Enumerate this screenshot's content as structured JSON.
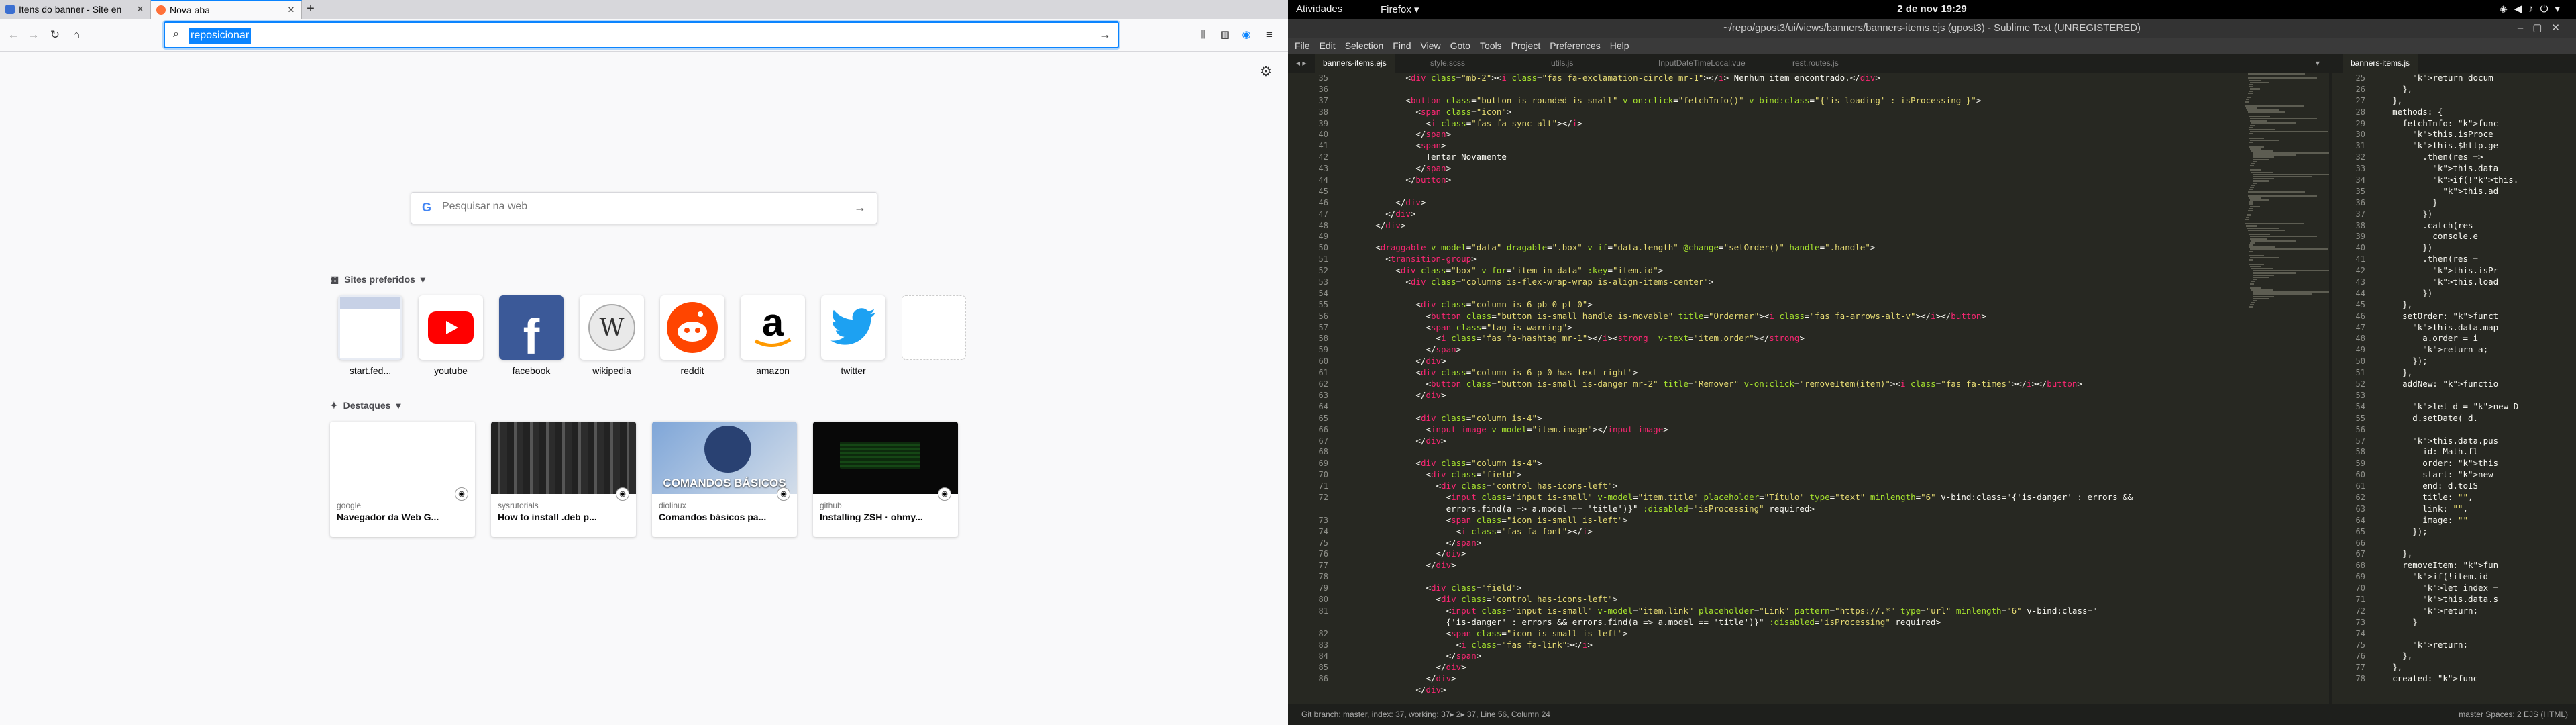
{
  "firefox": {
    "tabs": [
      {
        "title": "Itens do banner - Site en",
        "active": false
      },
      {
        "title": "Nova aba",
        "active": true
      }
    ],
    "url_value": "reposicionar",
    "search_placeholder": "Pesquisar na web",
    "top_sites_heading": "Sites preferidos",
    "top_sites": [
      "start.fed...",
      "youtube",
      "facebook",
      "wikipedia",
      "reddit",
      "amazon",
      "twitter",
      ""
    ],
    "highlights_heading": "Destaques",
    "highlights": [
      {
        "source": "google",
        "title": "Navegador da Web G..."
      },
      {
        "source": "sysrutorials",
        "title": "How to install .deb p..."
      },
      {
        "source": "diolinux",
        "title": "Comandos básicos pa...",
        "thumb_text": "COMANDOS BÁSICOS"
      },
      {
        "source": "github",
        "title": "Installing ZSH · ohmy..."
      }
    ]
  },
  "gnome": {
    "activities": "Atividades",
    "app": "Firefox ▾",
    "clock": "2 de nov  19:29"
  },
  "sublime": {
    "title": "~/repo/gpost3/ui/views/banners/banners-items.ejs (gpost3) - Sublime Text (UNREGISTERED)",
    "menu": [
      "File",
      "Edit",
      "Selection",
      "Find",
      "View",
      "Goto",
      "Tools",
      "Project",
      "Preferences",
      "Help"
    ],
    "tabs": [
      "banners-items.ejs",
      "style.scss",
      "utils.js",
      "InputDateTimeLocal.vue",
      "rest.routes.js"
    ],
    "right_tab": "banners-items.js",
    "status_left": "Git branch: master, index: 37, working: 37▸ 2▸ 37, Line 56, Column 24",
    "status_right": "master   Spaces: 2     EJS (HTML)",
    "line_start": 35,
    "code_lines": [
      "              <div class=\"mb-2\"><i class=\"fas fa-exclamation-circle mr-1\"></i> Nenhum item encontrado.</div>",
      "",
      "              <button class=\"button is-rounded is-small\" v-on:click=\"fetchInfo()\" v-bind:class=\"{'is-loading' : isProcessing }\">",
      "                <span class=\"icon\">",
      "                  <i class=\"fas fa-sync-alt\"></i>",
      "                </span>",
      "                <span>",
      "                  Tentar Novamente",
      "                </span>",
      "              </button>",
      "",
      "            </div>",
      "          </div>",
      "        </div>",
      "",
      "        <draggable v-model=\"data\" dragable=\".box\" v-if=\"data.length\" @change=\"setOrder()\" handle=\".handle\">",
      "          <transition-group>",
      "            <div class=\"box\" v-for=\"item in data\" :key=\"item.id\">",
      "              <div class=\"columns is-flex-wrap-wrap is-align-items-center\">",
      "",
      "                <div class=\"column is-6 pb-0 pt-0\">",
      "                  <button class=\"button is-small handle is-movable\" title=\"Ordernar\"><i class=\"fas fa-arrows-alt-v\"></i></button>",
      "                  <span class=\"tag is-warning\">",
      "                    <i class=\"fas fa-hashtag mr-1\"></i><strong  v-text=\"item.order\"></strong>",
      "                  </span>",
      "                </div>",
      "                <div class=\"column is-6 p-0 has-text-right\">",
      "                  <button class=\"button is-small is-danger mr-2\" title=\"Remover\" v-on:click=\"removeItem(item)\"><i class=\"fas fa-times\"></i></button>",
      "                </div>",
      "",
      "                <div class=\"column is-4\">",
      "                  <input-image v-model=\"item.image\"></input-image>",
      "                </div>",
      "",
      "                <div class=\"column is-4\">",
      "                  <div class=\"field\">",
      "                    <div class=\"control has-icons-left\">",
      "                      <input class=\"input is-small\" v-model=\"item.title\" placeholder=\"Título\" type=\"text\" minlength=\"6\" v-bind:class=\"{'is-danger' : errors &&",
      "                      errors.find(a => a.model == 'title')}\" :disabled=\"isProcessing\" required>",
      "                      <span class=\"icon is-small is-left\">",
      "                        <i class=\"fas fa-font\"></i>",
      "                      </span>",
      "                    </div>",
      "                  </div>",
      "",
      "                  <div class=\"field\">",
      "                    <div class=\"control has-icons-left\">",
      "                      <input class=\"input is-small\" v-model=\"item.link\" placeholder=\"Link\" pattern=\"https://.*\" type=\"url\" minlength=\"6\" v-bind:class=\"",
      "                      {'is-danger' : errors && errors.find(a => a.model == 'title')}\" :disabled=\"isProcessing\" required>",
      "                      <span class=\"icon is-small is-left\">",
      "                        <i class=\"fas fa-link\"></i>",
      "                      </span>",
      "                    </div>",
      "                  </div>",
      "                </div>"
    ],
    "line_numbers": [
      "35",
      "36",
      "37",
      "38",
      "39",
      "40",
      "41",
      "42",
      "43",
      "44",
      "45",
      "46",
      "47",
      "48",
      "49",
      "50",
      "51",
      "52",
      "53",
      "54",
      "55",
      "56",
      "57",
      "58",
      "59",
      "60",
      "61",
      "62",
      "63",
      "64",
      "65",
      "66",
      "67",
      "68",
      "69",
      "70",
      "71",
      "72",
      "",
      "73",
      "74",
      "75",
      "76",
      "77",
      "78",
      "79",
      "80",
      "81",
      "",
      "82",
      "83",
      "84",
      "85",
      "86"
    ],
    "right_lines": [
      "        return docum",
      "      },",
      "    },",
      "    methods: {",
      "      fetchInfo: func",
      "        this.isProce",
      "        this.$http.ge",
      "          .then(res =>",
      "            this.data",
      "            if(!this.",
      "              this.ad",
      "            }",
      "          })",
      "          .catch(res",
      "            console.e",
      "          })",
      "          .then(res =",
      "            this.isPr",
      "            this.load",
      "          })",
      "      },",
      "      setOrder: funct",
      "        this.data.map",
      "          a.order = i",
      "          return a;",
      "        });",
      "      },",
      "      addNew: functio",
      "",
      "        let d = new D",
      "        d.setDate( d.",
      "",
      "        this.data.pus",
      "          id: Math.fl",
      "          order: this",
      "          start: new",
      "          end: d.toIS",
      "          title: \"\",",
      "          link: \"\",",
      "          image: \"\"",
      "        });",
      "",
      "      },",
      "      removeItem: fun",
      "        if(!item.id",
      "          let index =",
      "          this.data.s",
      "          return;",
      "        }",
      "",
      "        return;",
      "      },",
      "    },",
      "    created: func"
    ],
    "right_line_start": 25
  }
}
